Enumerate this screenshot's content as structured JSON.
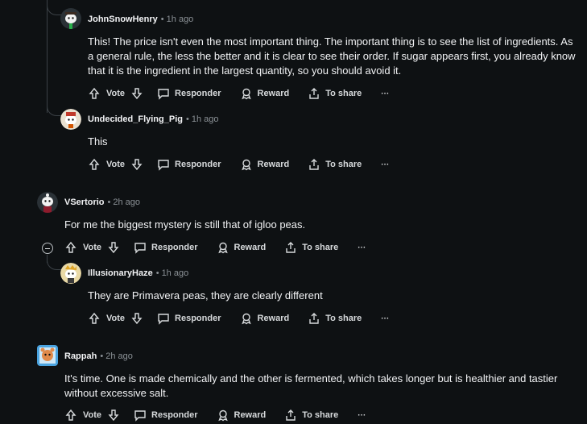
{
  "actions": {
    "vote": "Vote",
    "reply": "Responder",
    "reward": "Reward",
    "share": "To share",
    "more": "···"
  },
  "comments": [
    {
      "author": "JohnSnowHenry",
      "time": "1h ago",
      "text": "This! The price isn't even the most important thing. The important thing is to see the list of ingredients. As a general rule, the less the better and it is clear to see their order. If sugar appears first, you already know that it is the ingredient in the largest quantity, so you should avoid it."
    },
    {
      "author": "Undecided_Flying_Pig",
      "time": "1h ago",
      "text": "This"
    },
    {
      "author": "VSertorio",
      "time": "2h ago",
      "text": "For me the biggest mystery is still that of igloo peas."
    },
    {
      "author": "IllusionaryHaze",
      "time": "1h ago",
      "text": "They are Primavera peas, they are clearly different"
    },
    {
      "author": "Rappah",
      "time": "2h ago",
      "text": "It's time. One is made chemically and the other is fermented, which takes longer but is healthier and tastier without excessive salt."
    }
  ],
  "colors": {
    "background": "#0e1113",
    "text": "#f2f3f5",
    "muted": "#8b9196",
    "thread": "#3b4146"
  }
}
